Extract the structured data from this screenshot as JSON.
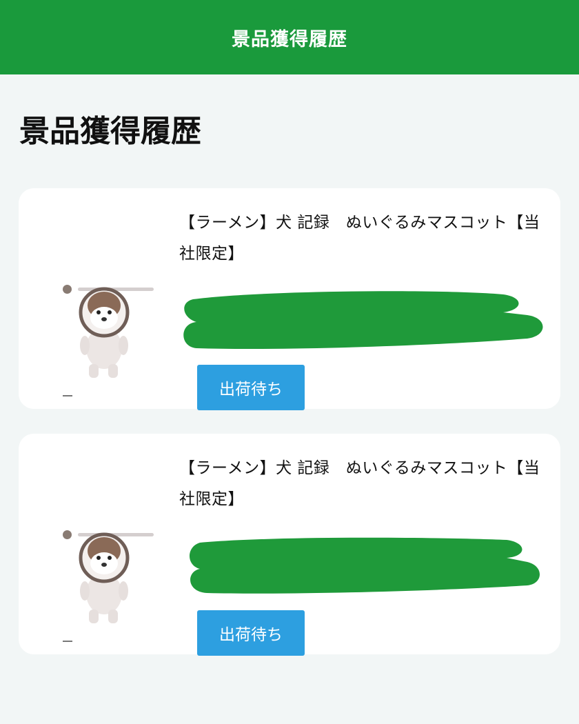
{
  "header": {
    "title": "景品獲得履歴"
  },
  "page": {
    "heading": "景品獲得履歴"
  },
  "items": [
    {
      "title": "【ラーメン】犬 記録　ぬいぐるみマスコット【当社限定】",
      "status": "出荷待ち",
      "image_icon": "dog-plush-mascot",
      "redaction_color": "#1f9a3a"
    },
    {
      "title": "【ラーメン】犬 記録　ぬいぐるみマスコット【当社限定】",
      "status": "出荷待ち",
      "image_icon": "dog-plush-mascot",
      "redaction_color": "#1f9a3a"
    }
  ],
  "colors": {
    "header_bg": "#1a9a3c",
    "page_bg": "#f2f6f6",
    "status_button": "#2d9fe0"
  }
}
